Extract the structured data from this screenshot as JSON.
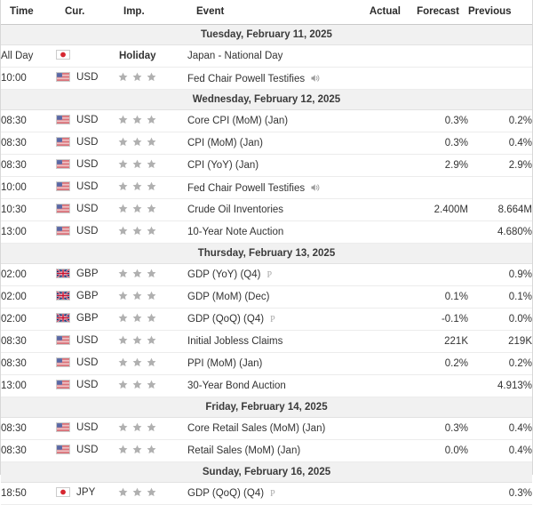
{
  "header": {
    "columns": [
      {
        "key": "time",
        "label": "Time"
      },
      {
        "key": "cur",
        "label": "Cur."
      },
      {
        "key": "imp",
        "label": "Imp."
      },
      {
        "key": "event",
        "label": "Event"
      },
      {
        "key": "actual",
        "label": "Actual"
      },
      {
        "key": "forecast",
        "label": "Forecast"
      },
      {
        "key": "previous",
        "label": "Previous"
      }
    ]
  },
  "colors": {
    "date_header_bg": "#f1f1f1",
    "row_border": "#ececec",
    "star_filled": "#b0b0b0",
    "text": "#333333",
    "prelim_marker": "#a8a8a8"
  },
  "icons": {
    "speaker": "speaker-icon",
    "preliminary": "preliminary-marker",
    "star": "star-icon"
  },
  "days": [
    {
      "date_label": "Tuesday, February 11, 2025",
      "events": [
        {
          "time": "All Day",
          "flag": "jp",
          "currency": "",
          "importance": 0,
          "holiday": "Holiday",
          "event": "Japan - National Day",
          "speaker": false,
          "preliminary": "",
          "actual": "",
          "forecast": "",
          "previous": ""
        },
        {
          "time": "10:00",
          "flag": "us",
          "currency": "USD",
          "importance": 3,
          "holiday": "",
          "event": "Fed Chair Powell Testifies",
          "speaker": true,
          "preliminary": "",
          "actual": "",
          "forecast": "",
          "previous": ""
        }
      ]
    },
    {
      "date_label": "Wednesday, February 12, 2025",
      "events": [
        {
          "time": "08:30",
          "flag": "us",
          "currency": "USD",
          "importance": 3,
          "holiday": "",
          "event": "Core CPI (MoM) (Jan)",
          "speaker": false,
          "preliminary": "",
          "actual": "",
          "forecast": "0.3%",
          "previous": "0.2%"
        },
        {
          "time": "08:30",
          "flag": "us",
          "currency": "USD",
          "importance": 3,
          "holiday": "",
          "event": "CPI (MoM) (Jan)",
          "speaker": false,
          "preliminary": "",
          "actual": "",
          "forecast": "0.3%",
          "previous": "0.4%"
        },
        {
          "time": "08:30",
          "flag": "us",
          "currency": "USD",
          "importance": 3,
          "holiday": "",
          "event": "CPI (YoY) (Jan)",
          "speaker": false,
          "preliminary": "",
          "actual": "",
          "forecast": "2.9%",
          "previous": "2.9%"
        },
        {
          "time": "10:00",
          "flag": "us",
          "currency": "USD",
          "importance": 3,
          "holiday": "",
          "event": "Fed Chair Powell Testifies",
          "speaker": true,
          "preliminary": "",
          "actual": "",
          "forecast": "",
          "previous": ""
        },
        {
          "time": "10:30",
          "flag": "us",
          "currency": "USD",
          "importance": 3,
          "holiday": "",
          "event": "Crude Oil Inventories",
          "speaker": false,
          "preliminary": "",
          "actual": "",
          "forecast": "2.400M",
          "previous": "8.664M"
        },
        {
          "time": "13:00",
          "flag": "us",
          "currency": "USD",
          "importance": 3,
          "holiday": "",
          "event": "10-Year Note Auction",
          "speaker": false,
          "preliminary": "",
          "actual": "",
          "forecast": "",
          "previous": "4.680%"
        }
      ]
    },
    {
      "date_label": "Thursday, February 13, 2025",
      "events": [
        {
          "time": "02:00",
          "flag": "gb",
          "currency": "GBP",
          "importance": 3,
          "holiday": "",
          "event": "GDP (YoY) (Q4)",
          "speaker": false,
          "preliminary": "P",
          "actual": "",
          "forecast": "",
          "previous": "0.9%"
        },
        {
          "time": "02:00",
          "flag": "gb",
          "currency": "GBP",
          "importance": 3,
          "holiday": "",
          "event": "GDP (MoM) (Dec)",
          "speaker": false,
          "preliminary": "",
          "actual": "",
          "forecast": "0.1%",
          "previous": "0.1%"
        },
        {
          "time": "02:00",
          "flag": "gb",
          "currency": "GBP",
          "importance": 3,
          "holiday": "",
          "event": "GDP (QoQ) (Q4)",
          "speaker": false,
          "preliminary": "P",
          "actual": "",
          "forecast": "-0.1%",
          "previous": "0.0%"
        },
        {
          "time": "08:30",
          "flag": "us",
          "currency": "USD",
          "importance": 3,
          "holiday": "",
          "event": "Initial Jobless Claims",
          "speaker": false,
          "preliminary": "",
          "actual": "",
          "forecast": "221K",
          "previous": "219K"
        },
        {
          "time": "08:30",
          "flag": "us",
          "currency": "USD",
          "importance": 3,
          "holiday": "",
          "event": "PPI (MoM) (Jan)",
          "speaker": false,
          "preliminary": "",
          "actual": "",
          "forecast": "0.2%",
          "previous": "0.2%"
        },
        {
          "time": "13:00",
          "flag": "us",
          "currency": "USD",
          "importance": 3,
          "holiday": "",
          "event": "30-Year Bond Auction",
          "speaker": false,
          "preliminary": "",
          "actual": "",
          "forecast": "",
          "previous": "4.913%"
        }
      ]
    },
    {
      "date_label": "Friday, February 14, 2025",
      "events": [
        {
          "time": "08:30",
          "flag": "us",
          "currency": "USD",
          "importance": 3,
          "holiday": "",
          "event": "Core Retail Sales (MoM) (Jan)",
          "speaker": false,
          "preliminary": "",
          "actual": "",
          "forecast": "0.3%",
          "previous": "0.4%"
        },
        {
          "time": "08:30",
          "flag": "us",
          "currency": "USD",
          "importance": 3,
          "holiday": "",
          "event": "Retail Sales (MoM) (Jan)",
          "speaker": false,
          "preliminary": "",
          "actual": "",
          "forecast": "0.0%",
          "previous": "0.4%"
        }
      ]
    },
    {
      "date_label": "Sunday, February 16, 2025",
      "events": [
        {
          "time": "18:50",
          "flag": "jp",
          "currency": "JPY",
          "importance": 3,
          "holiday": "",
          "event": "GDP (QoQ) (Q4)",
          "speaker": false,
          "preliminary": "P",
          "actual": "",
          "forecast": "",
          "previous": "0.3%"
        }
      ]
    }
  ]
}
